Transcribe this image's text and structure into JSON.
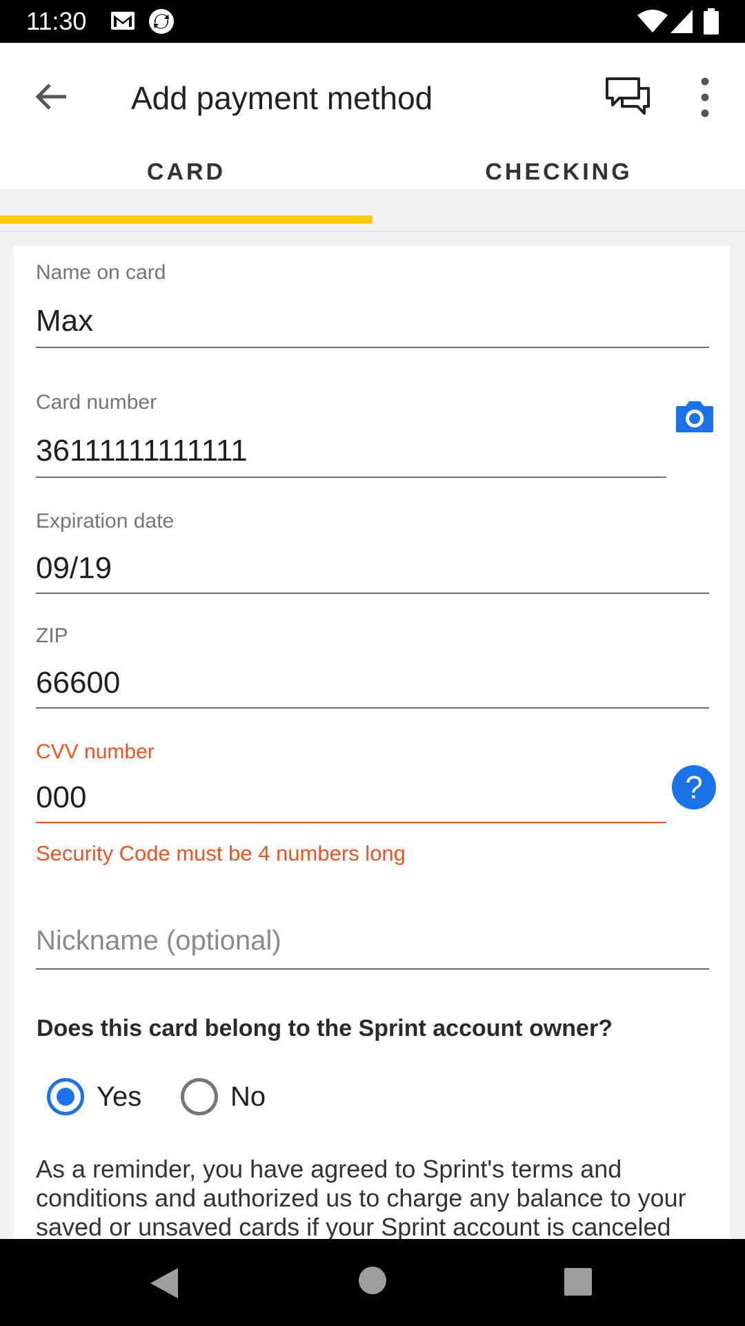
{
  "status_bar": {
    "time": "11:30"
  },
  "app_bar": {
    "title": "Add payment method"
  },
  "tabs": [
    {
      "label": "CARD",
      "selected": true
    },
    {
      "label": "CHECKING",
      "selected": false
    }
  ],
  "form": {
    "name": {
      "label": "Name on card",
      "value": "Max"
    },
    "card_number": {
      "label": "Card number",
      "value": "36111111111111"
    },
    "expiration": {
      "label": "Expiration date",
      "value": "09/19"
    },
    "zip": {
      "label": "ZIP",
      "value": "66600"
    },
    "cvv": {
      "label": "CVV number",
      "value": "000",
      "error": "Security Code must be 4 numbers long",
      "help_glyph": "?"
    },
    "nickname": {
      "placeholder": "Nickname (optional)",
      "value": ""
    }
  },
  "owner_question": {
    "text": "Does this card belong to the Sprint account owner?",
    "options": [
      {
        "label": "Yes",
        "selected": true
      },
      {
        "label": "No",
        "selected": false
      }
    ]
  },
  "reminder_text": "As a reminder, you have agreed to Sprint's terms and conditions and authorized us to charge any balance to your saved or unsaved cards if your Sprint account is canceled",
  "colors": {
    "accent_tab": "#fecb0c",
    "primary_blue": "#1a73e8",
    "error": "#f4511e"
  }
}
